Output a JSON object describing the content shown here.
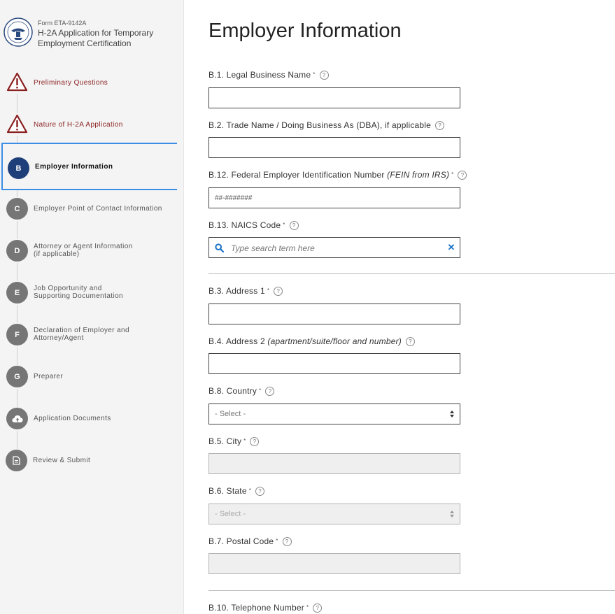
{
  "header": {
    "form_number": "Form ETA-9142A",
    "app_title": "H-2A Application for Temporary Employment Certification"
  },
  "sidebar": {
    "steps": [
      {
        "marker": "",
        "icon": "warning-icon",
        "label": "Preliminary Questions"
      },
      {
        "marker": "",
        "icon": "warning-icon",
        "label": "Nature of H-2A Application"
      },
      {
        "marker": "B",
        "label": "Employer Information"
      },
      {
        "marker": "C",
        "label": "Employer Point of Contact Information"
      },
      {
        "marker": "D",
        "label": "Attorney or Agent Information\n(if applicable)"
      },
      {
        "marker": "E",
        "label": "Job Opportunity and\nSupporting Documentation"
      },
      {
        "marker": "F",
        "label": "Declaration of Employer and\nAttorney/Agent"
      },
      {
        "marker": "G",
        "label": "Preparer"
      },
      {
        "marker": "",
        "icon": "cloud-upload-icon",
        "label": "Application Documents"
      },
      {
        "marker": "",
        "icon": "document-icon",
        "label": "Review & Submit"
      }
    ]
  },
  "main": {
    "page_title": "Employer Information",
    "fields": {
      "legal_name": {
        "code": "B.1. Legal Business Name",
        "required": "*"
      },
      "trade_name": {
        "code": "B.2. Trade Name / Doing Business As (DBA), if applicable"
      },
      "fein": {
        "code": "B.12. Federal Employer Identification Number",
        "note": "(FEIN from IRS)",
        "required": "*",
        "placeholder": "##-#######"
      },
      "naics": {
        "code": "B.13. NAICS Code",
        "required": "*",
        "placeholder": "Type search term here"
      },
      "address1": {
        "code": "B.3. Address 1",
        "required": "*"
      },
      "address2": {
        "code": "B.4. Address 2",
        "note": "(apartment/suite/floor and number)"
      },
      "country": {
        "code": "B.8. Country",
        "required": "*",
        "value": "- Select -"
      },
      "city": {
        "code": "B.5. City",
        "required": "*"
      },
      "state": {
        "code": "B.6. State",
        "required": "*",
        "value": "- Select -"
      },
      "postal": {
        "code": "B.7. Postal Code",
        "required": "*"
      },
      "phone": {
        "code": "B.10. Telephone Number",
        "required": "*"
      }
    }
  },
  "colors": {
    "active_border": "#3b8de6",
    "active_marker": "#1f3f7a",
    "warning": "#8a1f1f",
    "clear_icon": "#1a73c9"
  }
}
